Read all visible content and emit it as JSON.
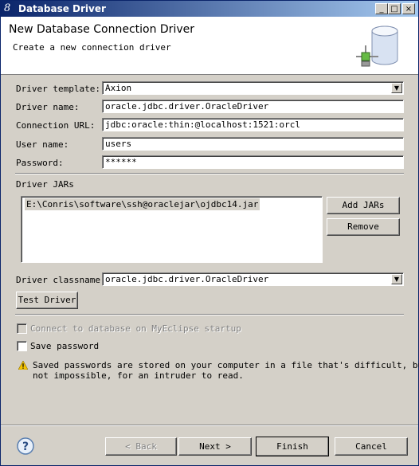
{
  "window": {
    "title": "Database Driver",
    "app_icon": "eclipse-8-icon",
    "controls": {
      "minimize": "_",
      "maximize": "□",
      "close": "×"
    }
  },
  "banner": {
    "heading": "New Database Connection Driver",
    "description": "Create a new connection driver",
    "icon": "database-icon"
  },
  "form": {
    "driver_template_label": "Driver template:",
    "driver_template_value": "Axion",
    "driver_name_label": "Driver name:",
    "driver_name_value": "oracle.jdbc.driver.OracleDriver",
    "connection_url_label": "Connection URL:",
    "connection_url_value": "jdbc:oracle:thin:@localhost:1521:orcl",
    "user_name_label": "User name:",
    "user_name_value": "users",
    "password_label": "Password:",
    "password_value": "******"
  },
  "jars": {
    "section_label": "Driver JARs",
    "items": [
      "E:\\Conris\\software\\ssh@oraclejar\\ojdbc14.jar"
    ],
    "add_label": "Add JARs",
    "remove_label": "Remove"
  },
  "classname": {
    "label": "Driver classname:",
    "value": "oracle.jdbc.driver.OracleDriver"
  },
  "test_driver_label": "Test Driver",
  "options": {
    "connect_on_startup_label": "Connect to database on MyEclipse startup",
    "connect_on_startup_checked": false,
    "connect_on_startup_enabled": false,
    "save_password_label": "Save password",
    "save_password_checked": false
  },
  "warning": {
    "icon": "warning-icon",
    "line1": "Saved passwords are stored on your computer in a file that's difficult, but",
    "line2": "not impossible, for an intruder to read."
  },
  "footer": {
    "help_icon": "help-icon",
    "back_label": "< Back",
    "next_label": "Next >",
    "finish_label": "Finish",
    "cancel_label": "Cancel"
  },
  "colors": {
    "title_bar_start": "#0a246a",
    "title_bar_end": "#a6caf0",
    "dialog_face": "#d4d0c8",
    "banner_bg": "#ffffff"
  }
}
